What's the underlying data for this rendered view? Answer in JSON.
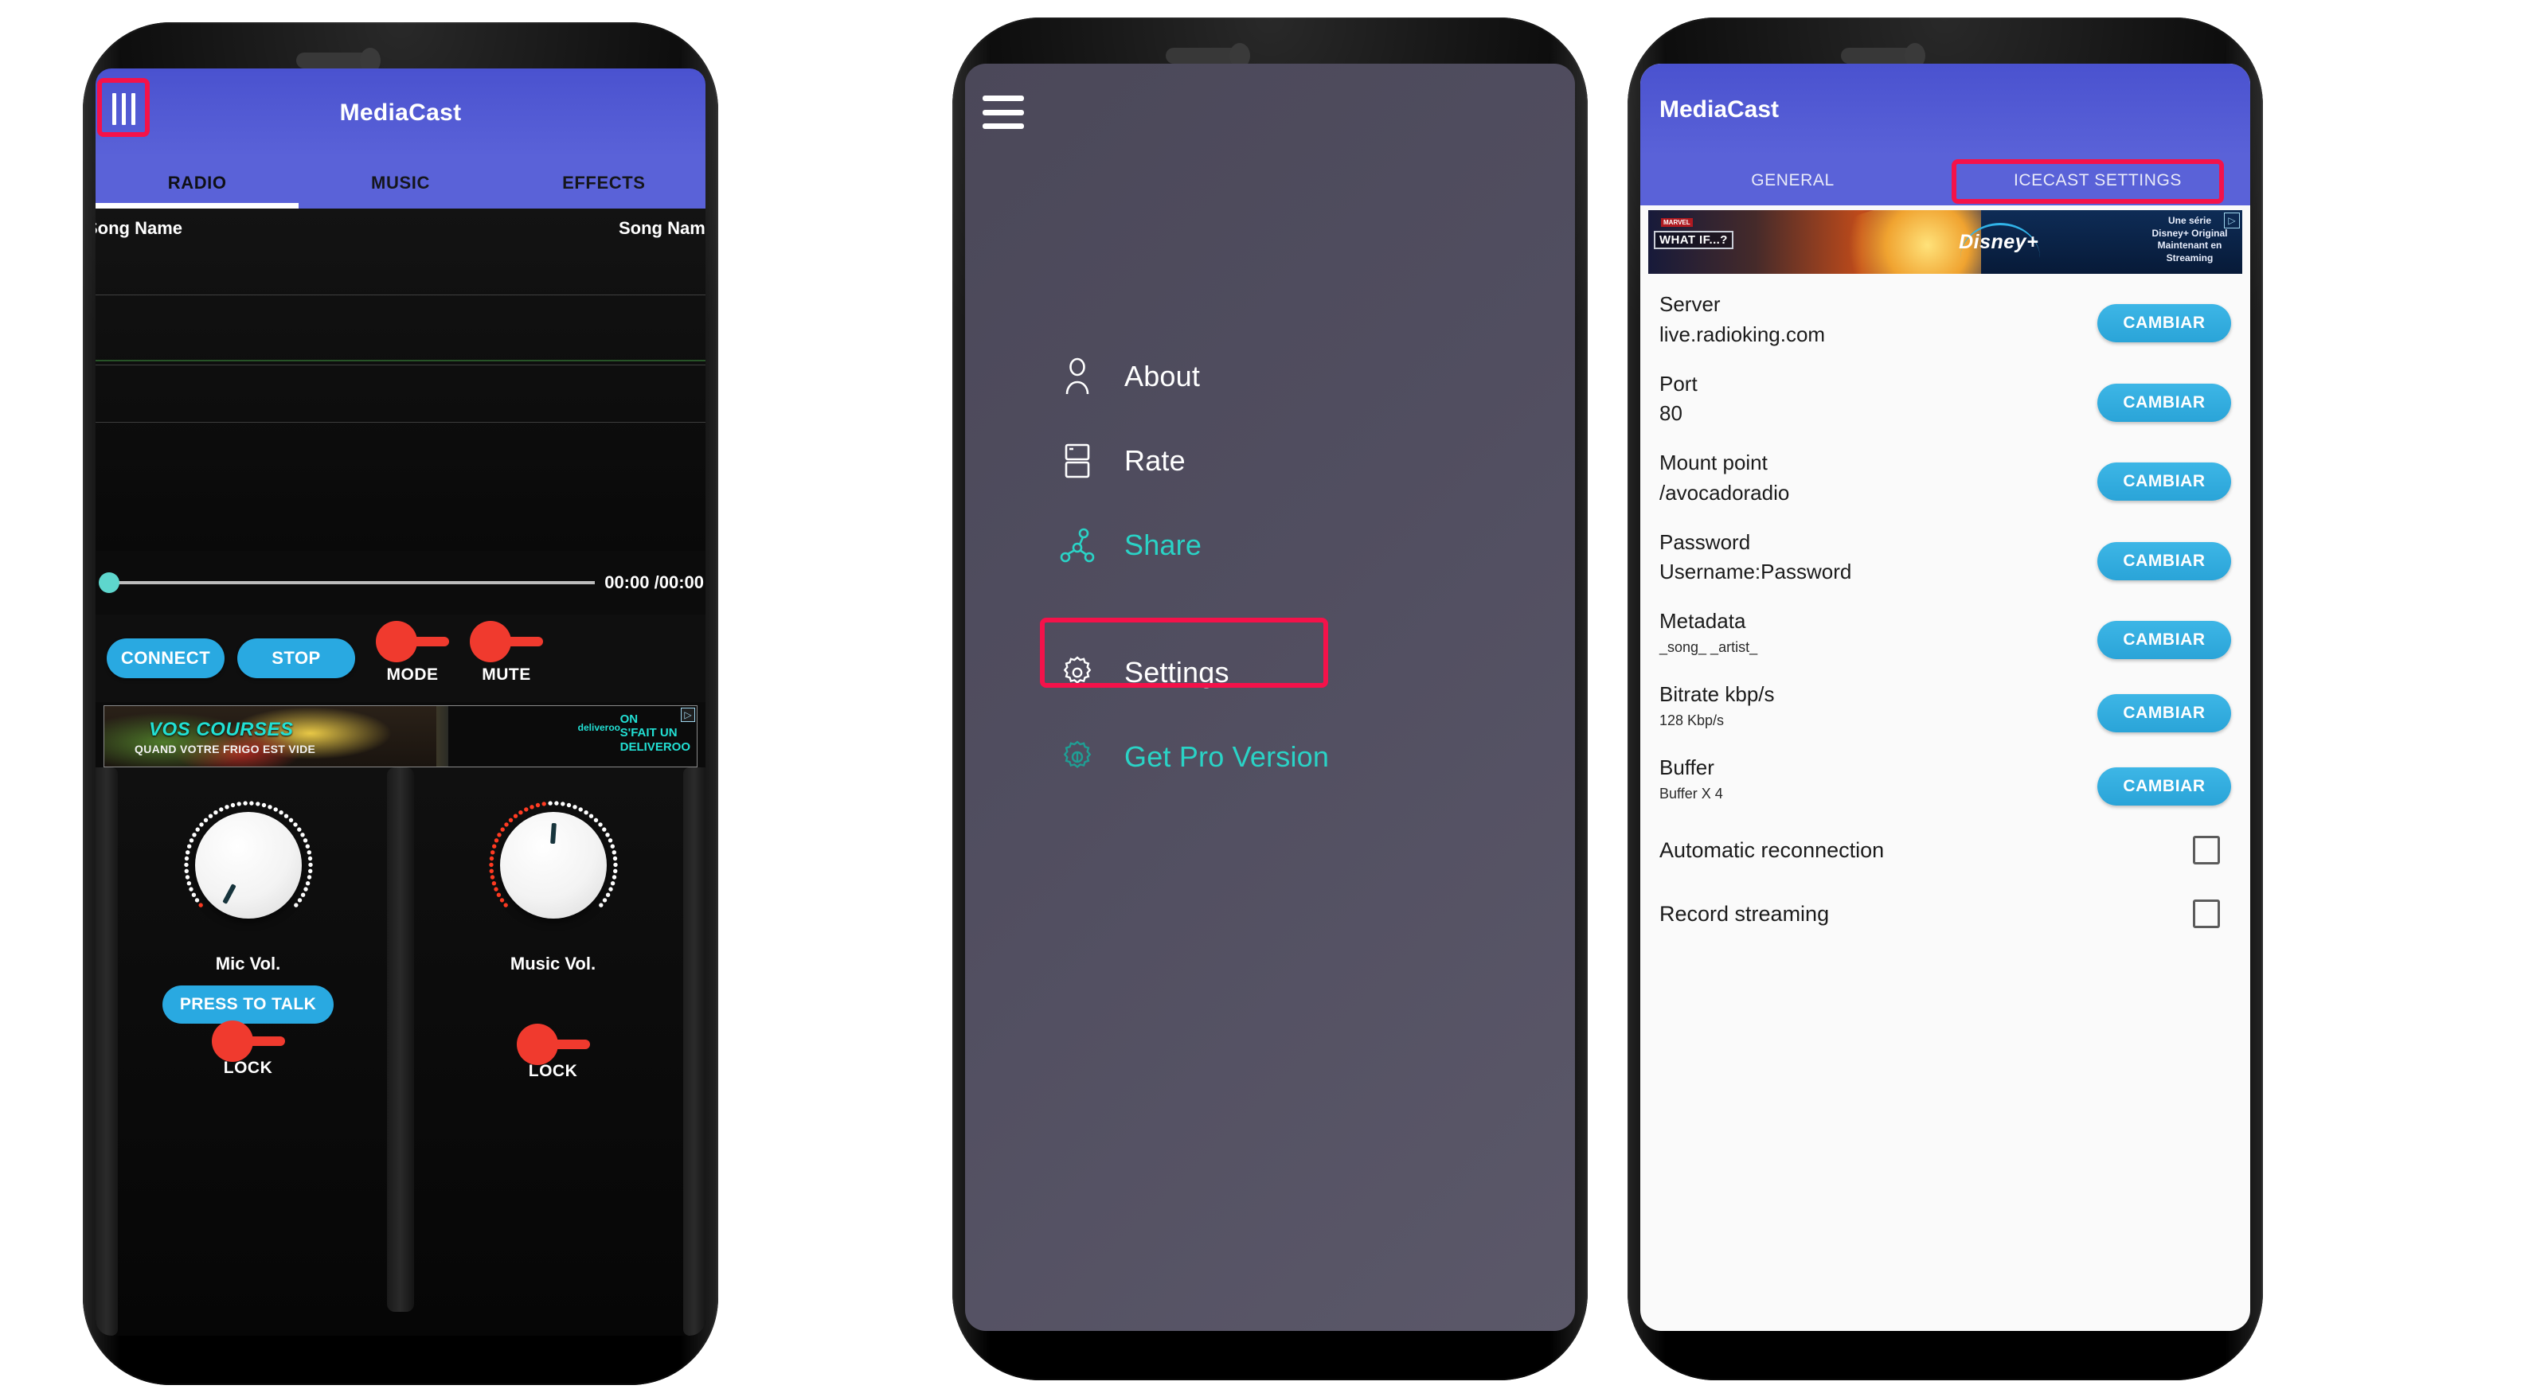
{
  "phone1": {
    "app_title": "MediaCast",
    "menu_icon": "hamburger-icon",
    "tabs": [
      {
        "label": "RADIO",
        "active": true
      },
      {
        "label": "MUSIC",
        "active": false
      },
      {
        "label": "EFFECTS",
        "active": false
      }
    ],
    "waveform": {
      "song_left": "Song Name",
      "song_right": "Song Name"
    },
    "player": {
      "elapsed": "00:00",
      "total": "/00:00",
      "seek_position_percent": 0
    },
    "controls": {
      "connect": "CONNECT",
      "stop": "STOP",
      "mode": "MODE",
      "mute": "MUTE"
    },
    "ad": {
      "headline": "VOS COURSES",
      "subline": "QUAND VOTRE FRIGO EST VIDE",
      "brand": "deliveroo",
      "tagline": "ON\nS'FAIT UN\nDELIVEROO",
      "ad_badge": "ⓘ▷"
    },
    "mixer": {
      "mic_label": "Mic Vol.",
      "music_label": "Music Vol.",
      "press_to_talk": "PRESS TO TALK",
      "lock_left": "LOCK",
      "lock_right": "LOCK"
    }
  },
  "phone2": {
    "menu_icon": "hamburger-icon",
    "items": [
      {
        "label": "About",
        "icon": "person-icon",
        "color": "white"
      },
      {
        "label": "Rate",
        "icon": "stars-icon",
        "color": "white"
      },
      {
        "label": "Share",
        "icon": "share-icon",
        "color": "teal"
      },
      {
        "label": "Settings",
        "icon": "gear-icon",
        "color": "white",
        "highlighted": true
      },
      {
        "label": "Get Pro Version",
        "icon": "gear-pro-icon",
        "color": "teal"
      }
    ]
  },
  "phone3": {
    "app_title": "MediaCast",
    "tabs": [
      {
        "label": "GENERAL",
        "active": false
      },
      {
        "label": "ICECAST SETTINGS",
        "active": true,
        "highlighted": true
      }
    ],
    "ad": {
      "title": "WHAT IF...?",
      "brand_badge": "MARVEL",
      "network": "Disney+",
      "tagline": "Une série\nDisney+ Original\nMaintenant en\nStreaming",
      "ad_badge": "▷"
    },
    "settings": [
      {
        "key": "Server",
        "value": "live.radioking.com",
        "action": "CAMBIAR",
        "small": false
      },
      {
        "key": "Port",
        "value": "80",
        "action": "CAMBIAR",
        "small": false
      },
      {
        "key": "Mount point",
        "value": "/avocadoradio",
        "action": "CAMBIAR",
        "small": false
      },
      {
        "key": "Password",
        "value": "Username:Password",
        "action": "CAMBIAR",
        "small": false
      },
      {
        "key": "Metadata",
        "value": "_song_ _artist_",
        "action": "CAMBIAR",
        "small": true
      },
      {
        "key": "Bitrate kbp/s",
        "value": "128 Kbp/s",
        "action": "CAMBIAR",
        "small": true
      },
      {
        "key": "Buffer",
        "value": "Buffer X 4",
        "action": "CAMBIAR",
        "small": true
      }
    ],
    "checkboxes": [
      {
        "label": "Automatic reconnection",
        "checked": false
      },
      {
        "label": "Record streaming",
        "checked": false
      }
    ]
  },
  "colors": {
    "highlight_red": "#f4124a",
    "app_blue": "#5a62d8",
    "action_blue": "#29a9e1",
    "teal": "#2ad3c6",
    "switch_red": "#f03a2e"
  }
}
